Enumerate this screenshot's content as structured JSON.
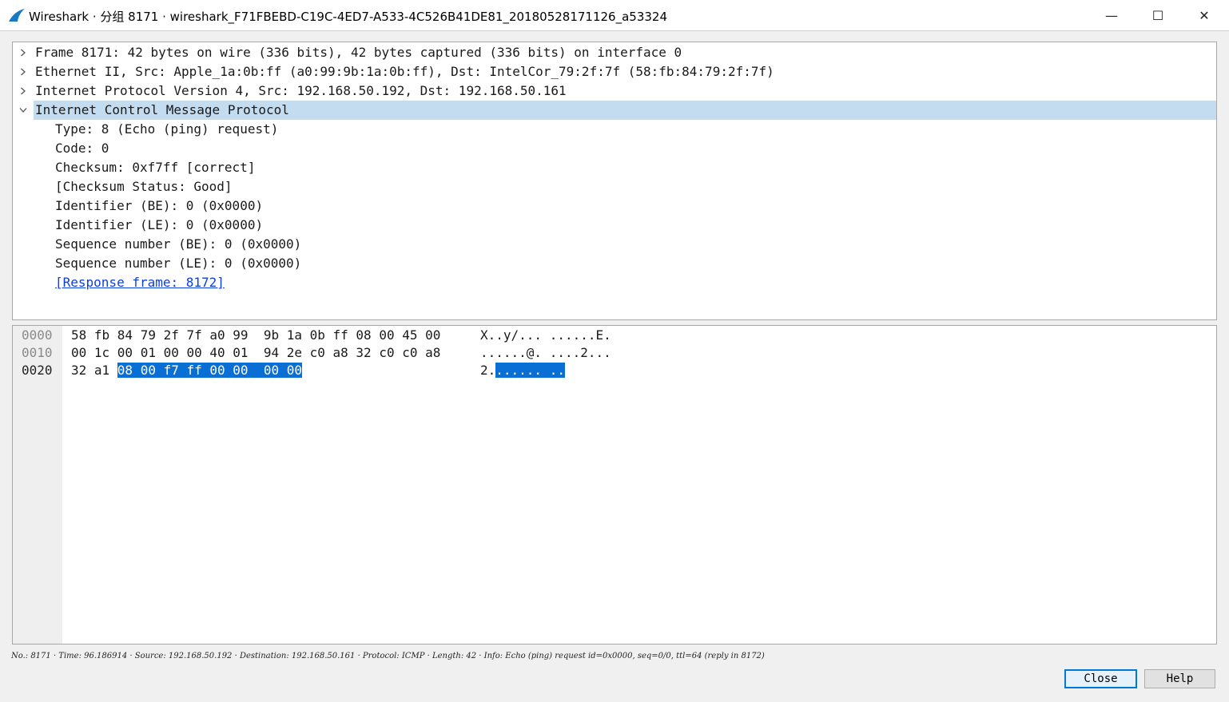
{
  "window": {
    "title": "Wireshark · 分组 8171 · wireshark_F71FBEBD-C19C-4ED7-A533-4C526B41DE81_20180528171126_a53324",
    "min_glyph": "—",
    "max_glyph": "☐",
    "close_glyph": "✕",
    "accent": "#0078d7"
  },
  "tree": {
    "nodes": [
      {
        "label": "Frame 8171: 42 bytes on wire (336 bits), 42 bytes captured (336 bits) on interface 0",
        "expanded": false
      },
      {
        "label": "Ethernet II, Src: Apple_1a:0b:ff (a0:99:9b:1a:0b:ff), Dst: IntelCor_79:2f:7f (58:fb:84:79:2f:7f)",
        "expanded": false
      },
      {
        "label": "Internet Protocol Version 4, Src: 192.168.50.192, Dst: 192.168.50.161",
        "expanded": false
      },
      {
        "label": "Internet Control Message Protocol",
        "expanded": true,
        "selected": true
      }
    ],
    "icmp_fields": [
      "Type: 8 (Echo (ping) request)",
      "Code: 0",
      "Checksum: 0xf7ff [correct]",
      "[Checksum Status: Good]",
      "Identifier (BE): 0 (0x0000)",
      "Identifier (LE): 0 (0x0000)",
      "Sequence number (BE): 0 (0x0000)",
      "Sequence number (LE): 0 (0x0000)"
    ],
    "response_link": "[Response frame: 8172]",
    "selection_color": "#c4dcf0"
  },
  "hex": {
    "rows": [
      {
        "offset": "0000",
        "bytes": "58 fb 84 79 2f 7f a0 99  9b 1a 0b ff 08 00 45 00",
        "ascii": "X..y/... ......E."
      },
      {
        "offset": "0010",
        "bytes": "00 1c 00 01 00 00 40 01  94 2e c0 a8 32 c0 c0 a8",
        "ascii": "......@. ....2..."
      },
      {
        "offset": "0020",
        "bytes_plain": "32 a1 ",
        "bytes_hl": "08 00 f7 ff 00 00  00 00",
        "ascii_plain": "2.",
        "ascii_hl": "...... .."
      }
    ],
    "highlight_color": "#0a6fd4"
  },
  "status": {
    "text": "No.: 8171 · Time: 96.186914 · Source: 192.168.50.192 · Destination: 192.168.50.161 · Protocol: ICMP · Length: 42 · Info: Echo (ping) request id=0x0000, seq=0/0, ttl=64 (reply in 8172)"
  },
  "buttons": {
    "close": "Close",
    "help": "Help"
  }
}
